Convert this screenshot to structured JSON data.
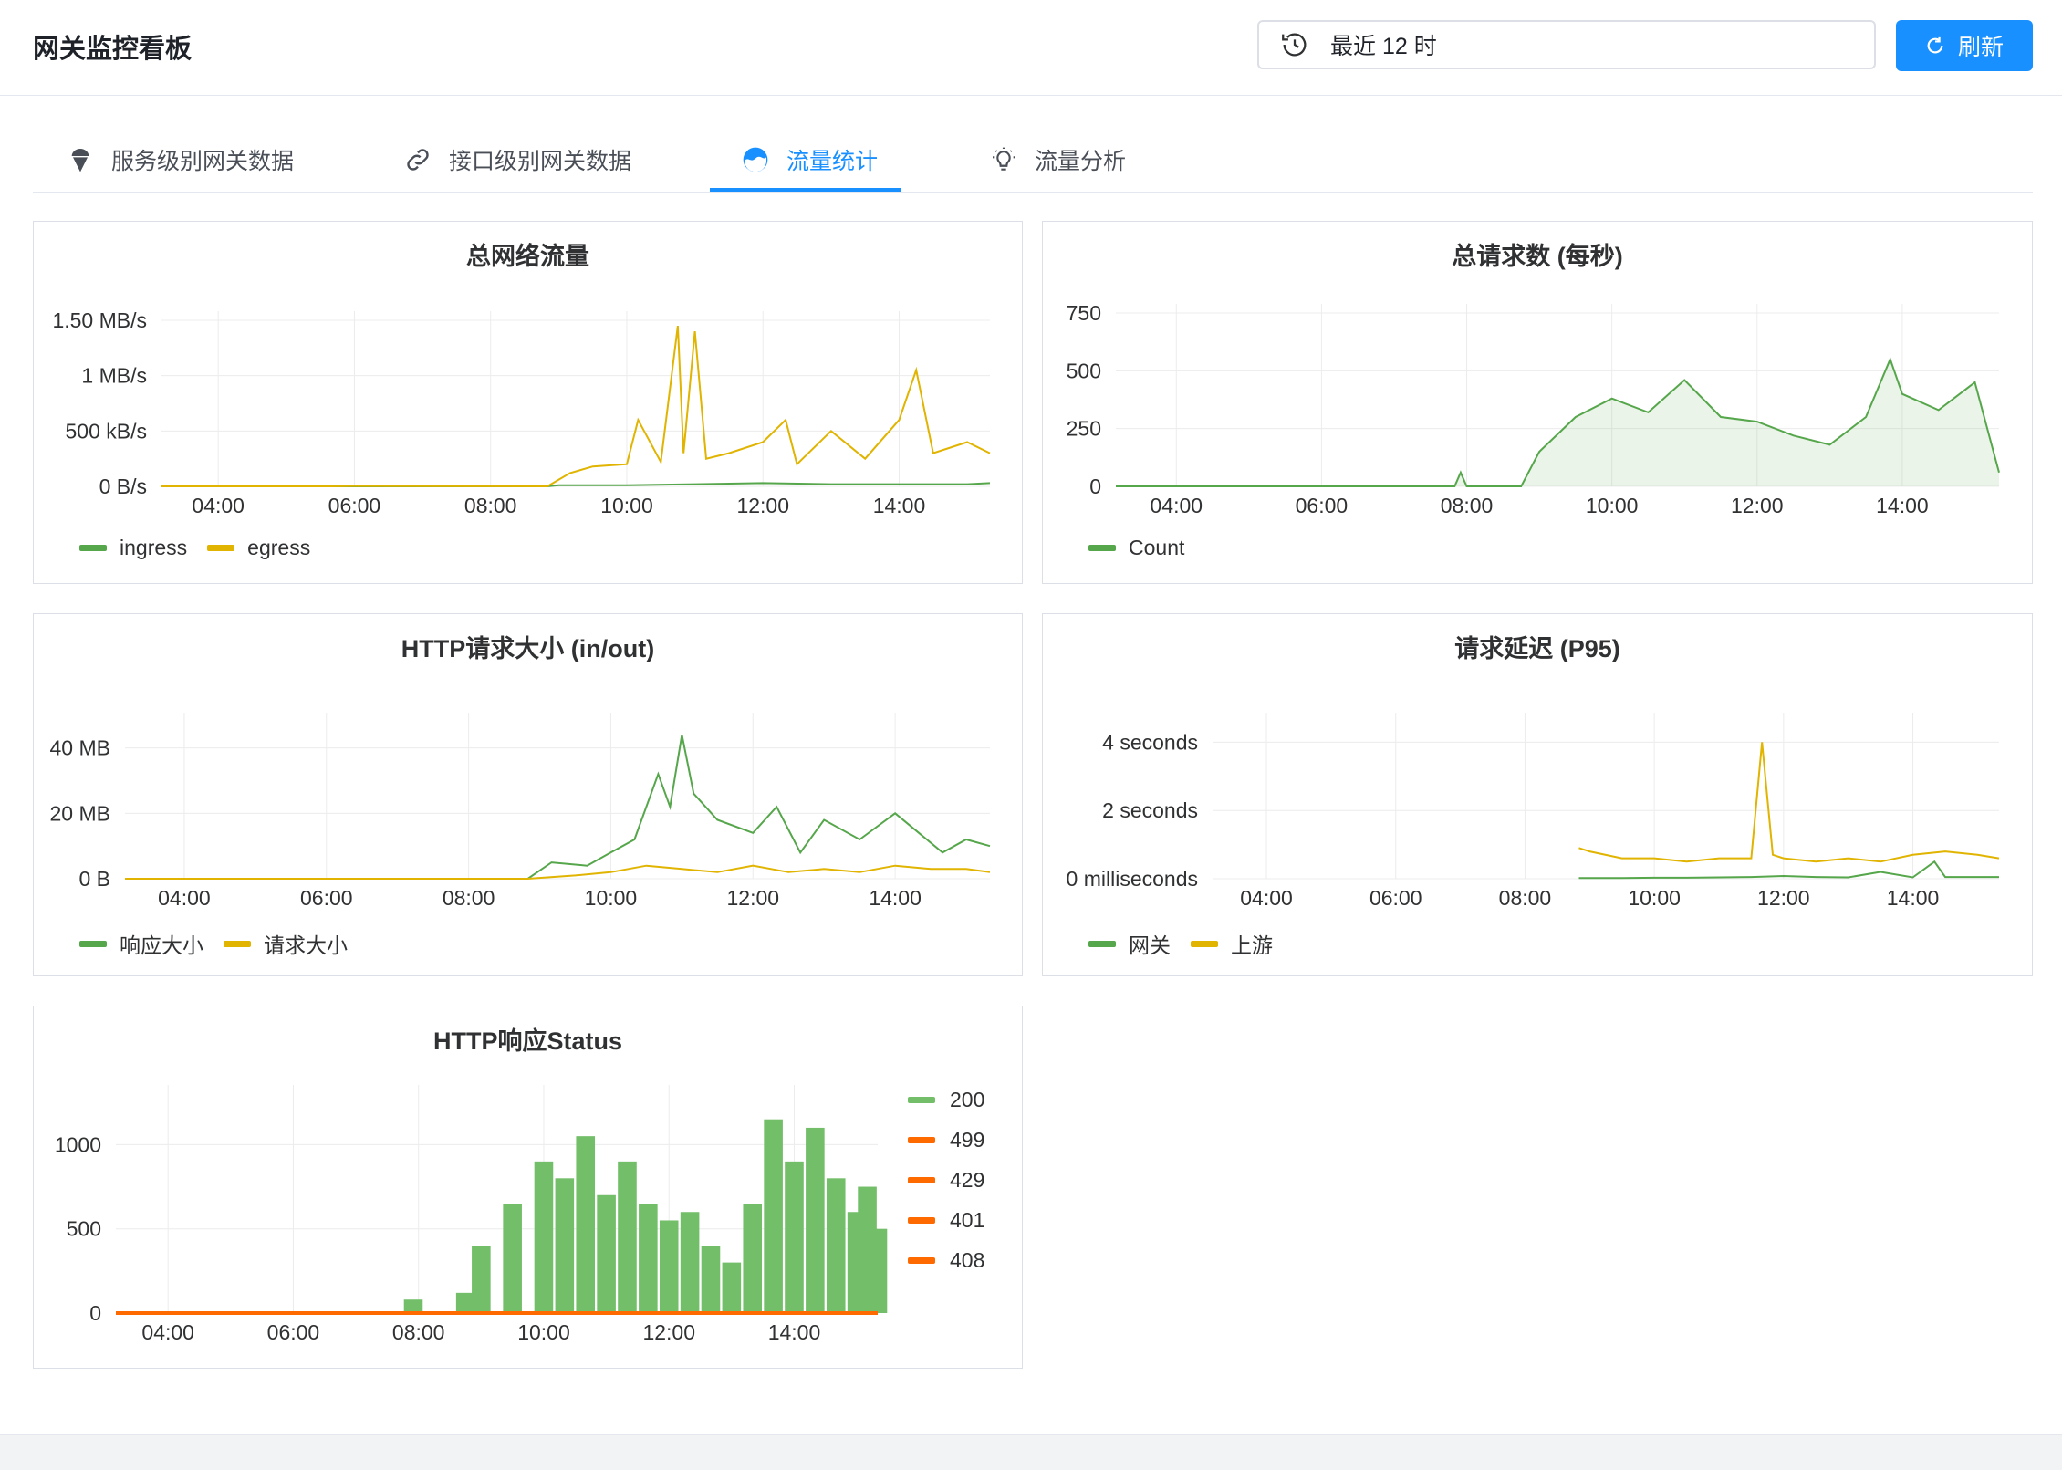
{
  "header": {
    "title": "网关监控看板",
    "time_range": "最近 12 时",
    "refresh_label": "刷新",
    "history_icon": "history-icon",
    "refresh_icon": "refresh-icon"
  },
  "tabs": [
    {
      "label": "服务级别网关数据",
      "icon": "ice-cream-icon",
      "active": false
    },
    {
      "label": "接口级别网关数据",
      "icon": "link-icon",
      "active": false
    },
    {
      "label": "流量统计",
      "icon": "wave-icon",
      "active": true
    },
    {
      "label": "流量分析",
      "icon": "bulb-icon",
      "active": false
    }
  ],
  "colors": {
    "green": "#56a64b",
    "yellow": "#e0b400",
    "orange": "#ff6a00",
    "accent": "#1890ff"
  },
  "chart_data": [
    {
      "id": "total_traffic",
      "type": "line",
      "title": "总网络流量",
      "x_ticks": [
        "04:00",
        "06:00",
        "08:00",
        "10:00",
        "12:00",
        "14:00"
      ],
      "x_range": [
        "03:10",
        "15:20"
      ],
      "y_ticks": [
        "0 B/s",
        "500 kB/s",
        "1 MB/s",
        "1.50 MB/s"
      ],
      "ylim": [
        0,
        1.5
      ],
      "y_unit": "MB/s",
      "series": [
        {
          "name": "ingress",
          "color": "#56a64b",
          "x": [
            "03:10",
            "08:50",
            "09:00",
            "10:00",
            "11:00",
            "12:00",
            "13:00",
            "14:00",
            "15:00",
            "15:20"
          ],
          "values": [
            0,
            0,
            0.01,
            0.01,
            0.02,
            0.03,
            0.02,
            0.02,
            0.02,
            0.03
          ]
        },
        {
          "name": "egress",
          "color": "#e0b400",
          "x": [
            "03:10",
            "05:40",
            "06:00",
            "08:50",
            "09:10",
            "09:30",
            "10:00",
            "10:10",
            "10:30",
            "10:45",
            "10:50",
            "11:00",
            "11:10",
            "11:30",
            "12:00",
            "12:20",
            "12:30",
            "13:00",
            "13:30",
            "14:00",
            "14:15",
            "14:30",
            "15:00",
            "15:20"
          ],
          "values": [
            0,
            0,
            0.003,
            0,
            0.12,
            0.18,
            0.2,
            0.6,
            0.22,
            1.45,
            0.3,
            1.4,
            0.25,
            0.3,
            0.4,
            0.6,
            0.2,
            0.5,
            0.25,
            0.6,
            1.05,
            0.3,
            0.4,
            0.3
          ]
        }
      ]
    },
    {
      "id": "total_requests",
      "type": "area",
      "title": "总请求数 (每秒)",
      "x_ticks": [
        "04:00",
        "06:00",
        "08:00",
        "10:00",
        "12:00",
        "14:00"
      ],
      "x_range": [
        "03:10",
        "15:20"
      ],
      "y_ticks": [
        "0",
        "250",
        "500",
        "750"
      ],
      "ylim": [
        0,
        750
      ],
      "series": [
        {
          "name": "Count",
          "color": "#56a64b",
          "x": [
            "03:10",
            "07:50",
            "07:55",
            "08:00",
            "08:45",
            "09:00",
            "09:30",
            "10:00",
            "10:30",
            "11:00",
            "11:30",
            "12:00",
            "12:30",
            "13:00",
            "13:30",
            "13:50",
            "14:00",
            "14:30",
            "15:00",
            "15:20"
          ],
          "values": [
            0,
            0,
            60,
            0,
            0,
            150,
            300,
            380,
            320,
            460,
            300,
            280,
            220,
            180,
            300,
            550,
            400,
            330,
            450,
            60
          ]
        }
      ]
    },
    {
      "id": "http_size",
      "type": "line",
      "title": "HTTP请求大小 (in/out)",
      "x_ticks": [
        "04:00",
        "06:00",
        "08:00",
        "10:00",
        "12:00",
        "14:00"
      ],
      "x_range": [
        "03:10",
        "15:20"
      ],
      "y_ticks": [
        "0 B",
        "20 MB",
        "40 MB"
      ],
      "ylim": [
        0,
        48
      ],
      "y_unit": "MB",
      "series": [
        {
          "name": "响应大小",
          "color": "#56a64b",
          "x": [
            "03:10",
            "08:50",
            "09:10",
            "09:40",
            "10:00",
            "10:20",
            "10:40",
            "10:50",
            "11:00",
            "11:10",
            "11:30",
            "12:00",
            "12:20",
            "12:40",
            "13:00",
            "13:30",
            "14:00",
            "14:20",
            "14:40",
            "15:00",
            "15:20"
          ],
          "values": [
            0,
            0,
            5,
            4,
            8,
            12,
            32,
            22,
            44,
            26,
            18,
            14,
            22,
            8,
            18,
            12,
            20,
            14,
            8,
            12,
            10
          ]
        },
        {
          "name": "请求大小",
          "color": "#e0b400",
          "x": [
            "03:10",
            "08:50",
            "09:30",
            "10:00",
            "10:30",
            "11:00",
            "11:30",
            "12:00",
            "12:30",
            "13:00",
            "13:30",
            "14:00",
            "14:30",
            "15:00",
            "15:20"
          ],
          "values": [
            0,
            0,
            1,
            2,
            4,
            3,
            2,
            4,
            2,
            3,
            2,
            4,
            3,
            3,
            2
          ]
        }
      ]
    },
    {
      "id": "latency_p95",
      "type": "line",
      "title": "请求延迟 (P95)",
      "x_ticks": [
        "04:00",
        "06:00",
        "08:00",
        "10:00",
        "12:00",
        "14:00"
      ],
      "x_range": [
        "03:10",
        "15:20"
      ],
      "y_ticks": [
        "0 milliseconds",
        "2 seconds",
        "4 seconds"
      ],
      "ylim": [
        0,
        4.6
      ],
      "y_unit": "seconds",
      "series": [
        {
          "name": "网关",
          "color": "#56a64b",
          "x": [
            "08:50",
            "09:30",
            "10:00",
            "10:30",
            "11:00",
            "11:30",
            "12:00",
            "12:30",
            "13:00",
            "13:30",
            "14:00",
            "14:20",
            "14:30",
            "15:00",
            "15:20"
          ],
          "values": [
            0.02,
            0.02,
            0.03,
            0.03,
            0.04,
            0.05,
            0.08,
            0.05,
            0.04,
            0.2,
            0.04,
            0.5,
            0.05,
            0.05,
            0.05
          ]
        },
        {
          "name": "上游",
          "color": "#e0b400",
          "x": [
            "08:50",
            "09:00",
            "09:30",
            "10:00",
            "10:30",
            "11:00",
            "11:30",
            "11:40",
            "11:50",
            "12:00",
            "12:30",
            "13:00",
            "13:30",
            "14:00",
            "14:30",
            "15:00",
            "15:20"
          ],
          "values": [
            0.9,
            0.8,
            0.6,
            0.6,
            0.5,
            0.6,
            0.6,
            4.0,
            0.7,
            0.6,
            0.5,
            0.6,
            0.5,
            0.7,
            0.8,
            0.7,
            0.6
          ]
        }
      ]
    },
    {
      "id": "http_status",
      "type": "bar",
      "title": "HTTP响应Status",
      "x_ticks": [
        "04:00",
        "06:00",
        "08:00",
        "10:00",
        "12:00",
        "14:00"
      ],
      "x_range": [
        "03:10",
        "15:20"
      ],
      "y_ticks": [
        "0",
        "500",
        "1000"
      ],
      "ylim": [
        0,
        1300
      ],
      "legend_position": "right",
      "series": [
        {
          "name": "200",
          "color": "#73bf69",
          "x": [
            "07:55",
            "08:45",
            "09:00",
            "09:30",
            "10:00",
            "10:20",
            "10:40",
            "11:00",
            "11:20",
            "11:40",
            "12:00",
            "12:20",
            "12:40",
            "13:00",
            "13:20",
            "13:40",
            "14:00",
            "14:20",
            "14:40",
            "15:00",
            "15:10",
            "15:20"
          ],
          "values": [
            80,
            120,
            400,
            650,
            900,
            800,
            1050,
            700,
            900,
            650,
            550,
            600,
            400,
            300,
            650,
            1150,
            900,
            1100,
            800,
            600,
            750,
            500
          ]
        },
        {
          "name": "499",
          "color": "#ff6a00",
          "x": [
            "03:10",
            "15:20"
          ],
          "values": [
            0,
            0
          ]
        },
        {
          "name": "429",
          "color": "#ff6a00",
          "x": [
            "03:10",
            "15:20"
          ],
          "values": [
            0,
            0
          ]
        },
        {
          "name": "401",
          "color": "#ff6a00",
          "x": [
            "03:10",
            "15:20"
          ],
          "values": [
            0,
            0
          ]
        },
        {
          "name": "408",
          "color": "#ff6a00",
          "x": [
            "03:10",
            "15:20"
          ],
          "values": [
            0,
            0
          ]
        }
      ]
    }
  ]
}
